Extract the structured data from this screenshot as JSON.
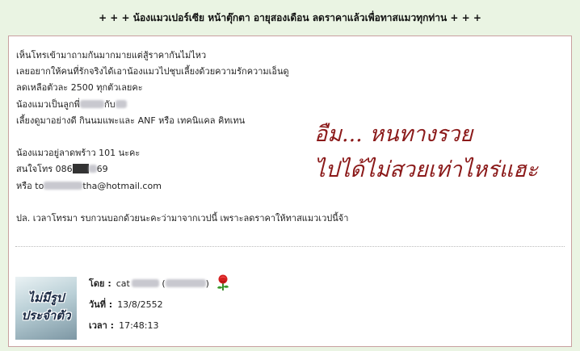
{
  "title": "+ + + น้องแมวเปอร์เซีย หน้าตุ๊กตา อายุสองเดือน ลดราคาแล้วเพื่อทาสแมวทุกท่าน + + +",
  "body": {
    "line1": "เห็นโทรเข้ามาถามกันมากมายแต่สู้ราคากันไม่ไหว",
    "line2": "เลยอยากให้คนที่รักจริงได้เอาน้องแมวไปชุบเลี้ยงด้วยความรักความเอ็นดู",
    "line3": "ลดเหลือตัวละ 2500 ทุกตัวเลยคะ",
    "line4a": "น้องแมวเป็นลูกพี่",
    "line4b": "กับ",
    "line5": "เลี้ยงดูมาอย่างดี กินนมแพะและ ANF หรือ เทคนิแคล คิทเทน",
    "line6": "น้องแมวอยู่ลาดพร้าว 101 นะคะ",
    "line7a": "สนใจโทร 086",
    "line7b": "69",
    "line8a": "หรือ to",
    "line8b": "tha@hotmail.com",
    "line9": "ปล. เวลาโทรมา รบกวนบอกด้วยนะคะว่ามาจากเวปนี้ เพราะลดราคาให้ทาสแมวเวปนี้จ้า"
  },
  "annotation": {
    "line1": "อืม...  หนทางรวย",
    "line2": "ไปได้ไม่สวยเท่าไหร่แฮะ"
  },
  "avatar": {
    "text_line1": "ไม่มีรูป",
    "text_line2": "ประจำตัว"
  },
  "meta": {
    "by_label": "โดย :",
    "by_value_prefix": "cat",
    "date_label": "วันที่ :",
    "date_value": "13/8/2552",
    "time_label": "เวลา :",
    "time_value": "17:48:13"
  },
  "colors": {
    "page_bg": "#eaf4e3",
    "box_border": "#c9a0a0",
    "annotation": "#8b1a1a"
  },
  "icons": {
    "rose": "rose-icon"
  }
}
